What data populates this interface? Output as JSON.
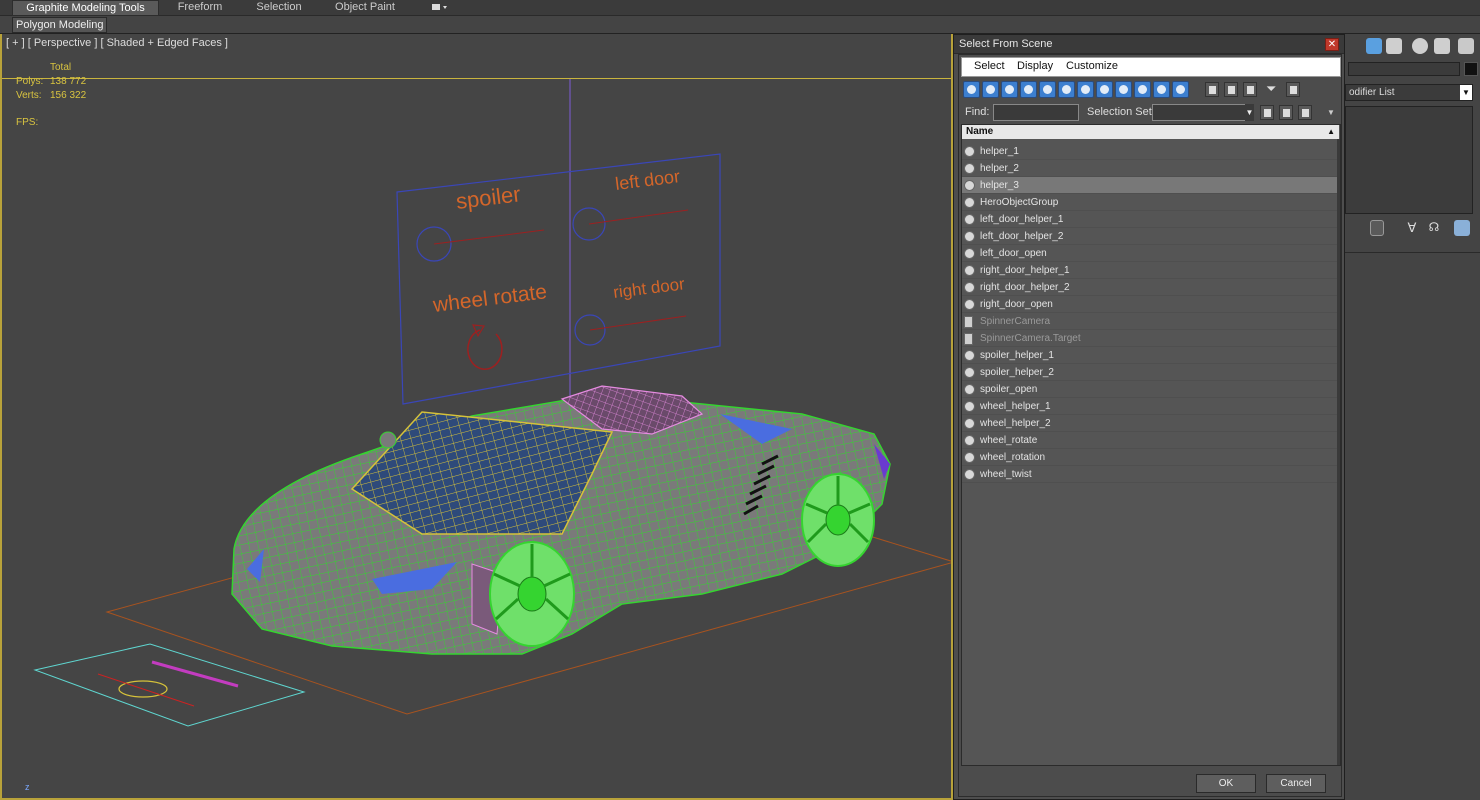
{
  "ribbon": {
    "tabs": [
      "Graphite Modeling Tools",
      "Freeform",
      "Selection",
      "Object Paint"
    ],
    "sub_label": "Polygon Modeling"
  },
  "viewport": {
    "label": "[ + ] [ Perspective ] [ Shaded + Edged Faces ]",
    "stats": {
      "total_label": "Total",
      "polys_label": "Polys:",
      "polys_value": "138 772",
      "verts_label": "Verts:",
      "verts_value": "156 322",
      "fps_label": "FPS:"
    },
    "scene_labels": {
      "spoiler": "spoiler",
      "left_door": "left door",
      "wheel_rotate": "wheel rotate",
      "right_door": "right door"
    },
    "axis_label": "z",
    "colors": {
      "frame": "#c9b43e",
      "wire_green": "#35d430",
      "wire_pink": "#e58be0",
      "wire_yellow": "#d6c23a",
      "label_orange": "#d4662a",
      "panel_blue": "#3a46b8",
      "floor_orange": "#a8531f",
      "cyan": "#5fd6d0"
    }
  },
  "dialog": {
    "title": "Select From Scene",
    "close_glyph": "✕",
    "menu": [
      "Select",
      "Display",
      "Customize"
    ],
    "find_label": "Find:",
    "find_value": "",
    "selection_set_label": "Selection Set:",
    "column_name": "Name",
    "rows": [
      {
        "name": "helper_1",
        "selected": false,
        "dim": false,
        "icon": "helper-icon"
      },
      {
        "name": "helper_2",
        "selected": false,
        "dim": false,
        "icon": "helper-icon"
      },
      {
        "name": "helper_3",
        "selected": true,
        "dim": false,
        "icon": "helper-icon"
      },
      {
        "name": "HeroObjectGroup",
        "selected": false,
        "dim": false,
        "icon": "group-icon"
      },
      {
        "name": "left_door_helper_1",
        "selected": false,
        "dim": false,
        "icon": "helper-icon"
      },
      {
        "name": "left_door_helper_2",
        "selected": false,
        "dim": false,
        "icon": "helper-icon"
      },
      {
        "name": "left_door_open",
        "selected": false,
        "dim": false,
        "icon": "helper-icon"
      },
      {
        "name": "right_door_helper_1",
        "selected": false,
        "dim": false,
        "icon": "helper-icon"
      },
      {
        "name": "right_door_helper_2",
        "selected": false,
        "dim": false,
        "icon": "helper-icon"
      },
      {
        "name": "right_door_open",
        "selected": false,
        "dim": false,
        "icon": "helper-icon"
      },
      {
        "name": "SpinnerCamera",
        "selected": false,
        "dim": true,
        "icon": "camera-icon"
      },
      {
        "name": "SpinnerCamera.Target",
        "selected": false,
        "dim": true,
        "icon": "camera-icon"
      },
      {
        "name": "spoiler_helper_1",
        "selected": false,
        "dim": false,
        "icon": "helper-icon"
      },
      {
        "name": "spoiler_helper_2",
        "selected": false,
        "dim": false,
        "icon": "helper-icon"
      },
      {
        "name": "spoiler_open",
        "selected": false,
        "dim": false,
        "icon": "helper-icon"
      },
      {
        "name": "wheel_helper_1",
        "selected": false,
        "dim": false,
        "icon": "helper-icon"
      },
      {
        "name": "wheel_helper_2",
        "selected": false,
        "dim": false,
        "icon": "helper-icon"
      },
      {
        "name": "wheel_rotate",
        "selected": false,
        "dim": false,
        "icon": "helper-icon"
      },
      {
        "name": "wheel_rotation",
        "selected": false,
        "dim": false,
        "icon": "helper-icon"
      },
      {
        "name": "wheel_twist",
        "selected": false,
        "dim": false,
        "icon": "helper-icon"
      }
    ],
    "ok_label": "OK",
    "cancel_label": "Cancel"
  },
  "command_panel": {
    "modifier_list": "odifier List"
  }
}
